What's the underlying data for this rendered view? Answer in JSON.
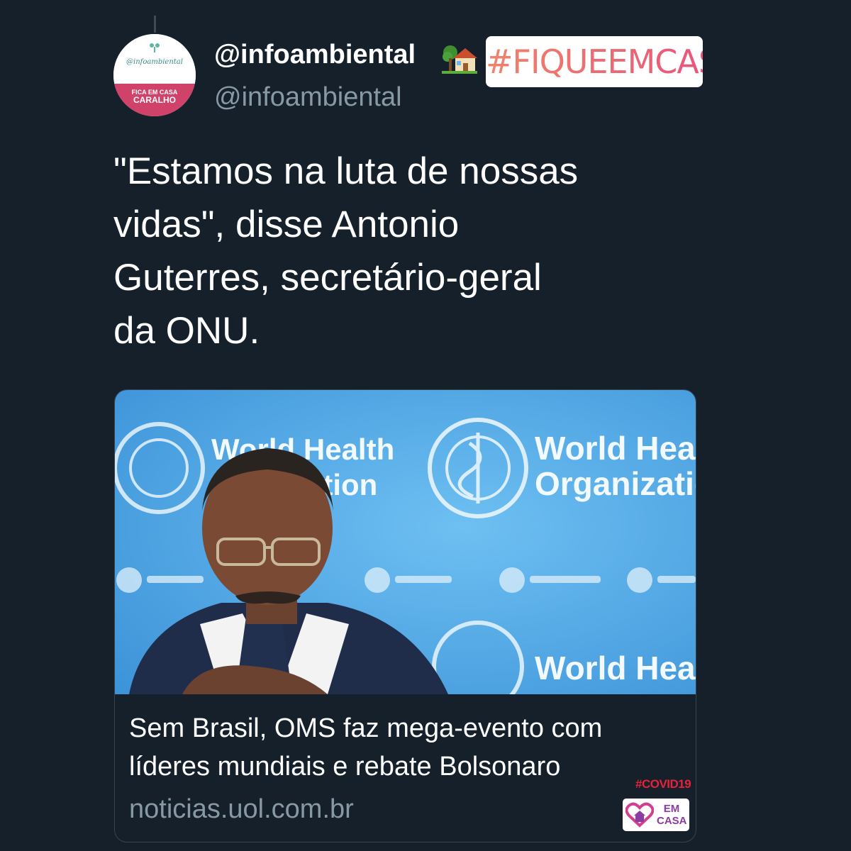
{
  "tweet": {
    "display_name": "@infoambiental",
    "username": "@infoambiental",
    "name_emoji_icon": "house-with-tree-icon",
    "avatar": {
      "handle": "@infoambiental",
      "line1": "FICA EM CASA",
      "line2": "CARALHO"
    },
    "text_lines": [
      "\"Estamos na luta de nossas",
      "vidas\", disse Antonio",
      "Guterres, secretário-geral",
      "da ONU."
    ]
  },
  "sticker": {
    "hashtag": "#FIQUEEMCASA",
    "colors": [
      "#f0836a",
      "#e8567a"
    ]
  },
  "link_card": {
    "image_alt_icon": "news-photo-who-press-conference",
    "image_text": {
      "logo_line1": "World Health",
      "logo_line2": "Organization",
      "logo_partial_line1": "World Health",
      "logo_partial_line2": "ation"
    },
    "title_lines": [
      "Sem Brasil, OMS faz mega-evento com",
      "líderes mundiais e rebate Bolsonaro"
    ],
    "domain": "noticias.uol.com.br"
  },
  "overlay": {
    "covid_tag": "#COVID19",
    "emcasa_line1": "EM",
    "emcasa_line2": "CASA"
  },
  "colors": {
    "background": "#15202b",
    "secondary_text": "#8899a6",
    "border": "#38444d",
    "avatar_pink": "#d0426a",
    "covid_red": "#e3233a",
    "who_blue": "#4aa3e0"
  }
}
